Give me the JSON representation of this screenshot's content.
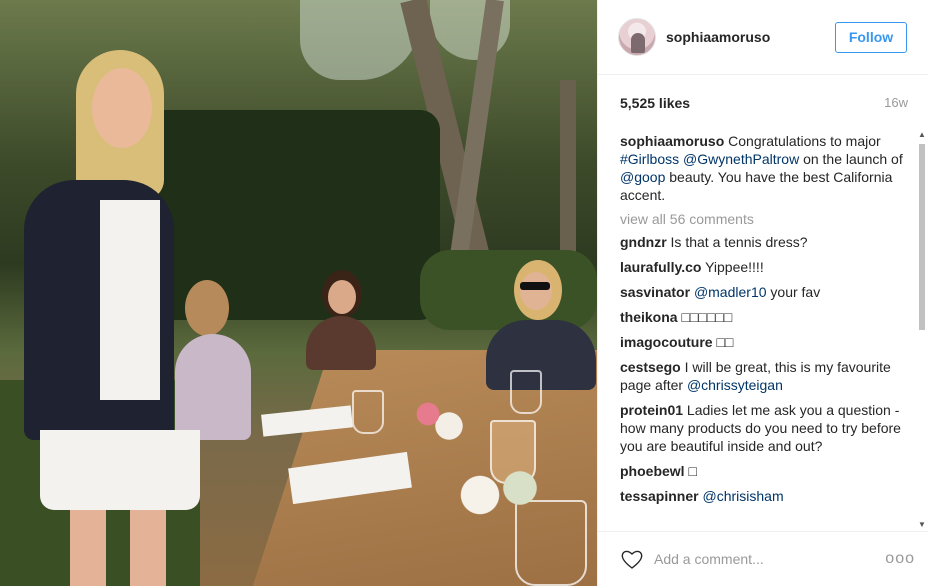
{
  "post": {
    "username": "sophiaamoruso",
    "follow_label": "Follow",
    "likes": "5,525 likes",
    "age": "16w",
    "caption": {
      "username": "sophiaamoruso",
      "parts": [
        {
          "text": " Congratulations to major ",
          "type": "text"
        },
        {
          "text": "#Girlboss",
          "type": "link"
        },
        {
          "text": " ",
          "type": "text"
        },
        {
          "text": "@GwynethPaltrow",
          "type": "link"
        },
        {
          "text": " on the launch of ",
          "type": "text"
        },
        {
          "text": "@goop",
          "type": "link"
        },
        {
          "text": " beauty. You have the best California accent.",
          "type": "text"
        }
      ]
    },
    "view_all_label": "view all 56 comments",
    "comments": [
      {
        "user": "gndnzr",
        "parts": [
          {
            "text": " Is that a tennis dress?",
            "type": "text"
          }
        ]
      },
      {
        "user": "laurafully.co",
        "parts": [
          {
            "text": " Yippee!!!!",
            "type": "text"
          }
        ]
      },
      {
        "user": "sasvinator",
        "parts": [
          {
            "text": " ",
            "type": "text"
          },
          {
            "text": "@madler10",
            "type": "link"
          },
          {
            "text": " your fav",
            "type": "text"
          }
        ]
      },
      {
        "user": "theikona",
        "parts": [
          {
            "text": " □□□□□□",
            "type": "text"
          }
        ]
      },
      {
        "user": "imagocouture",
        "parts": [
          {
            "text": " □□",
            "type": "text"
          }
        ]
      },
      {
        "user": "cestsego",
        "parts": [
          {
            "text": " I will be great, this is my favourite page after ",
            "type": "text"
          },
          {
            "text": "@chrissyteigan",
            "type": "link"
          }
        ]
      },
      {
        "user": "protein01",
        "parts": [
          {
            "text": " Ladies let me ask you a question - how many products do you need to try before you are beautiful inside and out?",
            "type": "text"
          }
        ]
      },
      {
        "user": "phoebewl",
        "parts": [
          {
            "text": " □",
            "type": "text"
          }
        ]
      },
      {
        "user": "tessapinner",
        "parts": [
          {
            "text": " ",
            "type": "text"
          },
          {
            "text": "@chrisisham",
            "type": "link"
          }
        ]
      }
    ],
    "add_comment_placeholder": "Add a comment...",
    "more_label": "ooo"
  },
  "icons": {
    "heart": "heart-outline-icon",
    "avatar": "profile-avatar",
    "scroll_up": "scroll-up-arrow",
    "scroll_down": "scroll-down-arrow"
  },
  "colors": {
    "link": "#003569",
    "follow_blue": "#3897f0",
    "muted": "#999999",
    "text": "#262626"
  }
}
